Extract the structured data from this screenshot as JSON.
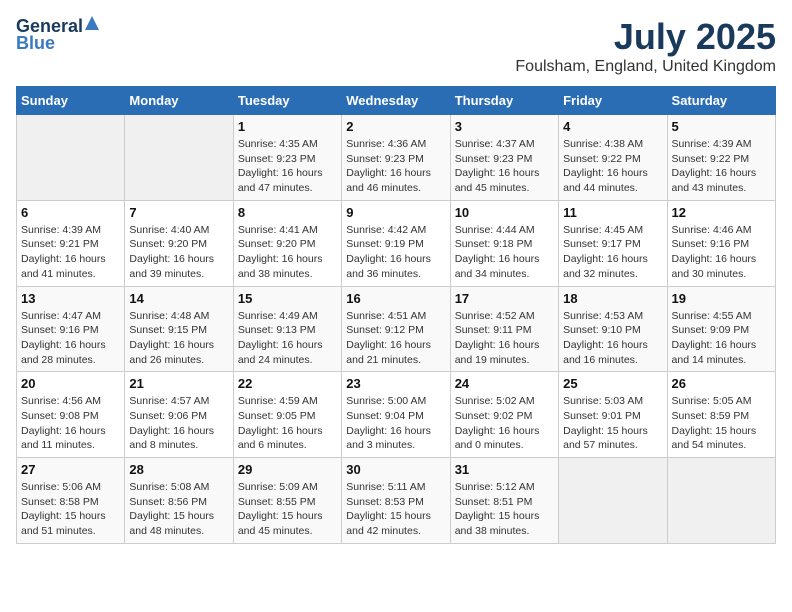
{
  "logo": {
    "general": "General",
    "blue": "Blue"
  },
  "title": "July 2025",
  "subtitle": "Foulsham, England, United Kingdom",
  "days_of_week": [
    "Sunday",
    "Monday",
    "Tuesday",
    "Wednesday",
    "Thursday",
    "Friday",
    "Saturday"
  ],
  "weeks": [
    [
      {
        "day": "",
        "info": ""
      },
      {
        "day": "",
        "info": ""
      },
      {
        "day": "1",
        "info": "Sunrise: 4:35 AM\nSunset: 9:23 PM\nDaylight: 16 hours and 47 minutes."
      },
      {
        "day": "2",
        "info": "Sunrise: 4:36 AM\nSunset: 9:23 PM\nDaylight: 16 hours and 46 minutes."
      },
      {
        "day": "3",
        "info": "Sunrise: 4:37 AM\nSunset: 9:23 PM\nDaylight: 16 hours and 45 minutes."
      },
      {
        "day": "4",
        "info": "Sunrise: 4:38 AM\nSunset: 9:22 PM\nDaylight: 16 hours and 44 minutes."
      },
      {
        "day": "5",
        "info": "Sunrise: 4:39 AM\nSunset: 9:22 PM\nDaylight: 16 hours and 43 minutes."
      }
    ],
    [
      {
        "day": "6",
        "info": "Sunrise: 4:39 AM\nSunset: 9:21 PM\nDaylight: 16 hours and 41 minutes."
      },
      {
        "day": "7",
        "info": "Sunrise: 4:40 AM\nSunset: 9:20 PM\nDaylight: 16 hours and 39 minutes."
      },
      {
        "day": "8",
        "info": "Sunrise: 4:41 AM\nSunset: 9:20 PM\nDaylight: 16 hours and 38 minutes."
      },
      {
        "day": "9",
        "info": "Sunrise: 4:42 AM\nSunset: 9:19 PM\nDaylight: 16 hours and 36 minutes."
      },
      {
        "day": "10",
        "info": "Sunrise: 4:44 AM\nSunset: 9:18 PM\nDaylight: 16 hours and 34 minutes."
      },
      {
        "day": "11",
        "info": "Sunrise: 4:45 AM\nSunset: 9:17 PM\nDaylight: 16 hours and 32 minutes."
      },
      {
        "day": "12",
        "info": "Sunrise: 4:46 AM\nSunset: 9:16 PM\nDaylight: 16 hours and 30 minutes."
      }
    ],
    [
      {
        "day": "13",
        "info": "Sunrise: 4:47 AM\nSunset: 9:16 PM\nDaylight: 16 hours and 28 minutes."
      },
      {
        "day": "14",
        "info": "Sunrise: 4:48 AM\nSunset: 9:15 PM\nDaylight: 16 hours and 26 minutes."
      },
      {
        "day": "15",
        "info": "Sunrise: 4:49 AM\nSunset: 9:13 PM\nDaylight: 16 hours and 24 minutes."
      },
      {
        "day": "16",
        "info": "Sunrise: 4:51 AM\nSunset: 9:12 PM\nDaylight: 16 hours and 21 minutes."
      },
      {
        "day": "17",
        "info": "Sunrise: 4:52 AM\nSunset: 9:11 PM\nDaylight: 16 hours and 19 minutes."
      },
      {
        "day": "18",
        "info": "Sunrise: 4:53 AM\nSunset: 9:10 PM\nDaylight: 16 hours and 16 minutes."
      },
      {
        "day": "19",
        "info": "Sunrise: 4:55 AM\nSunset: 9:09 PM\nDaylight: 16 hours and 14 minutes."
      }
    ],
    [
      {
        "day": "20",
        "info": "Sunrise: 4:56 AM\nSunset: 9:08 PM\nDaylight: 16 hours and 11 minutes."
      },
      {
        "day": "21",
        "info": "Sunrise: 4:57 AM\nSunset: 9:06 PM\nDaylight: 16 hours and 8 minutes."
      },
      {
        "day": "22",
        "info": "Sunrise: 4:59 AM\nSunset: 9:05 PM\nDaylight: 16 hours and 6 minutes."
      },
      {
        "day": "23",
        "info": "Sunrise: 5:00 AM\nSunset: 9:04 PM\nDaylight: 16 hours and 3 minutes."
      },
      {
        "day": "24",
        "info": "Sunrise: 5:02 AM\nSunset: 9:02 PM\nDaylight: 16 hours and 0 minutes."
      },
      {
        "day": "25",
        "info": "Sunrise: 5:03 AM\nSunset: 9:01 PM\nDaylight: 15 hours and 57 minutes."
      },
      {
        "day": "26",
        "info": "Sunrise: 5:05 AM\nSunset: 8:59 PM\nDaylight: 15 hours and 54 minutes."
      }
    ],
    [
      {
        "day": "27",
        "info": "Sunrise: 5:06 AM\nSunset: 8:58 PM\nDaylight: 15 hours and 51 minutes."
      },
      {
        "day": "28",
        "info": "Sunrise: 5:08 AM\nSunset: 8:56 PM\nDaylight: 15 hours and 48 minutes."
      },
      {
        "day": "29",
        "info": "Sunrise: 5:09 AM\nSunset: 8:55 PM\nDaylight: 15 hours and 45 minutes."
      },
      {
        "day": "30",
        "info": "Sunrise: 5:11 AM\nSunset: 8:53 PM\nDaylight: 15 hours and 42 minutes."
      },
      {
        "day": "31",
        "info": "Sunrise: 5:12 AM\nSunset: 8:51 PM\nDaylight: 15 hours and 38 minutes."
      },
      {
        "day": "",
        "info": ""
      },
      {
        "day": "",
        "info": ""
      }
    ]
  ]
}
